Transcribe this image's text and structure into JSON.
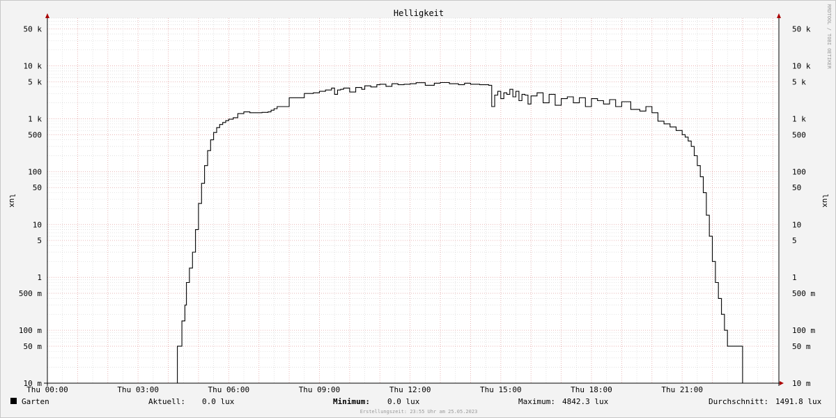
{
  "chart_data": {
    "type": "line",
    "title": "Helligkeit",
    "ylabel": "lux",
    "yscale": "log",
    "ylim": [
      0.01,
      80000
    ],
    "xlim": [
      0,
      24.2
    ],
    "y_ticks": [
      {
        "v": 50000,
        "label": "50 k"
      },
      {
        "v": 10000,
        "label": "10 k"
      },
      {
        "v": 5000,
        "label": "5 k"
      },
      {
        "v": 1000,
        "label": "1 k"
      },
      {
        "v": 500,
        "label": "500"
      },
      {
        "v": 100,
        "label": "100"
      },
      {
        "v": 50,
        "label": "50"
      },
      {
        "v": 10,
        "label": "10"
      },
      {
        "v": 5,
        "label": "5"
      },
      {
        "v": 1,
        "label": "1"
      },
      {
        "v": 0.5,
        "label": "500 m"
      },
      {
        "v": 0.1,
        "label": "100 m"
      },
      {
        "v": 0.05,
        "label": "50 m"
      },
      {
        "v": 0.01,
        "label": "10 m"
      }
    ],
    "x_ticks": [
      {
        "h": 0,
        "label": "Thu 00:00"
      },
      {
        "h": 3,
        "label": "Thu 03:00"
      },
      {
        "h": 6,
        "label": "Thu 06:00"
      },
      {
        "h": 9,
        "label": "Thu 09:00"
      },
      {
        "h": 12,
        "label": "Thu 12:00"
      },
      {
        "h": 15,
        "label": "Thu 15:00"
      },
      {
        "h": 18,
        "label": "Thu 18:00"
      },
      {
        "h": 21,
        "label": "Thu 21:00"
      }
    ],
    "grid": true,
    "series": [
      {
        "name": "Garten",
        "color": "#000000",
        "x": [
          0,
          4.3,
          4.3,
          4.45,
          4.45,
          4.55,
          4.6,
          4.7,
          4.8,
          4.9,
          5.0,
          5.1,
          5.2,
          5.3,
          5.4,
          5.5,
          5.6,
          5.7,
          5.8,
          5.9,
          6.0,
          6.15,
          6.3,
          6.5,
          6.7,
          6.9,
          7.1,
          7.3,
          7.4,
          7.5,
          7.6,
          8.0,
          8.5,
          8.8,
          9.0,
          9.2,
          9.4,
          9.5,
          9.6,
          9.7,
          9.8,
          10.0,
          10.2,
          10.4,
          10.5,
          10.7,
          10.9,
          11.0,
          11.2,
          11.4,
          11.6,
          11.8,
          12.0,
          12.2,
          12.5,
          12.8,
          13.0,
          13.3,
          13.6,
          13.8,
          14.0,
          14.3,
          14.6,
          14.7,
          14.8,
          14.9,
          15.0,
          15.1,
          15.2,
          15.3,
          15.4,
          15.5,
          15.6,
          15.7,
          15.8,
          15.9,
          16.0,
          16.2,
          16.4,
          16.6,
          16.8,
          17.0,
          17.2,
          17.4,
          17.6,
          17.8,
          18.0,
          18.2,
          18.4,
          18.6,
          18.8,
          19.0,
          19.3,
          19.6,
          19.8,
          20.0,
          20.2,
          20.4,
          20.6,
          20.8,
          21.0,
          21.1,
          21.2,
          21.3,
          21.4,
          21.5,
          21.6,
          21.7,
          21.8,
          21.9,
          22.0,
          22.1,
          22.2,
          22.3,
          22.4,
          22.5,
          22.6,
          22.7,
          22.8,
          22.9,
          23.0,
          23.0,
          24.2
        ],
        "values": [
          0.01,
          0.01,
          0.05,
          0.05,
          0.15,
          0.3,
          0.8,
          1.5,
          3,
          8,
          25,
          60,
          130,
          250,
          400,
          550,
          680,
          780,
          850,
          920,
          980,
          1050,
          1250,
          1350,
          1300,
          1300,
          1320,
          1350,
          1450,
          1550,
          1700,
          2500,
          3000,
          3100,
          3300,
          3500,
          3800,
          2900,
          3500,
          3600,
          3800,
          3200,
          3900,
          3600,
          4200,
          4000,
          4400,
          4500,
          4100,
          4600,
          4400,
          4500,
          4600,
          4800,
          4300,
          4700,
          4842,
          4600,
          4400,
          4700,
          4500,
          4400,
          4300,
          1700,
          2800,
          3300,
          2400,
          3100,
          2900,
          3600,
          2600,
          3300,
          2200,
          2900,
          2800,
          1900,
          2700,
          3100,
          2000,
          2900,
          1800,
          2400,
          2600,
          2000,
          2500,
          1700,
          2400,
          2200,
          1900,
          2300,
          1700,
          2100,
          1500,
          1400,
          1700,
          1300,
          900,
          800,
          700,
          600,
          500,
          450,
          380,
          300,
          200,
          130,
          80,
          40,
          15,
          6,
          2,
          0.8,
          0.4,
          0.2,
          0.1,
          0.05,
          0.05,
          0.05,
          0.05,
          0.05,
          0.01,
          0.01,
          0.01
        ]
      }
    ]
  },
  "watermark": "RRDTOOL / TOBI OETIKER",
  "legend": {
    "series_name": "Garten",
    "swatch_color": "#000000",
    "current_label": "Aktuell:",
    "current_value": "0.0 lux",
    "min_label": "Minimum:",
    "min_value": "0.0 lux",
    "max_label": "Maximum:",
    "max_value": "4842.3 lux",
    "avg_label": "Durchschnitt:",
    "avg_value": "1491.8 lux"
  },
  "footer": "Erstellungszeit: 23:55 Uhr am 25.05.2023"
}
